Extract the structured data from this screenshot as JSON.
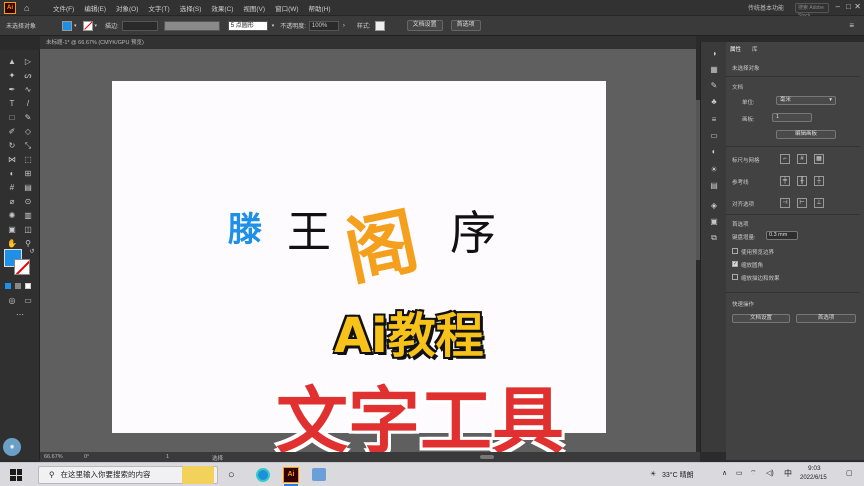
{
  "app": {
    "logo_text": "Ai",
    "workspace": "传统基本功能",
    "search_placeholder": "搜索 Adobe Stock"
  },
  "menu": [
    "文件(F)",
    "编辑(E)",
    "对象(O)",
    "文字(T)",
    "选择(S)",
    "效果(C)",
    "视图(V)",
    "窗口(W)",
    "帮助(H)"
  ],
  "control": {
    "label": "未选择对象",
    "stroke_label": "描边:",
    "brush_value": "5 点圆形",
    "opacity_label": "不透明度:",
    "opacity_value": "100%",
    "style_label": "样式:",
    "doc_setup": "文档设置",
    "prefs": "首选项"
  },
  "doc_tab": "未标题-1* @ 66.67% (CMYK/GPU 预览)",
  "status": {
    "zoom": "66.67%",
    "angle": "0°",
    "page": "1",
    "tool": "选择"
  },
  "properties": {
    "tabs": [
      "属性",
      "库"
    ],
    "selection": "未选择对象",
    "document_heading": "文档",
    "units_label": "单位:",
    "units_value": "毫米",
    "artboard_label": "画板:",
    "artboard_value": "1",
    "edit_artboards": "编辑画板",
    "rulers_grids": "标尺与网格",
    "guides": "参考线",
    "snap": "对齐选项",
    "prefs_heading": "首选项",
    "keyboard_increment_label": "键盘增量:",
    "keyboard_increment_value": "0.3 mm",
    "check1": "使用预览边界",
    "check2": "缩放圆角",
    "check3": "缩放描边和效果",
    "quick_actions": "快速操作",
    "doc_setup_btn": "文档设置",
    "prefs_btn": "首选项"
  },
  "artwork": {
    "chars": [
      "滕",
      "王",
      "阁",
      "序"
    ]
  },
  "overlay": {
    "title": "Ai教程",
    "subtitle": "文字工具"
  },
  "taskbar": {
    "search_text": "在这里输入你要搜索的内容",
    "weather": "33°C 晴朗",
    "time": "9:03",
    "date": "2022/6/15",
    "ime": "中"
  },
  "colors": {
    "accent_blue": "#1e90e8",
    "title_yellow": "#f7c21a",
    "subtitle_red": "#e03030",
    "char_orange": "#f4a01c"
  }
}
